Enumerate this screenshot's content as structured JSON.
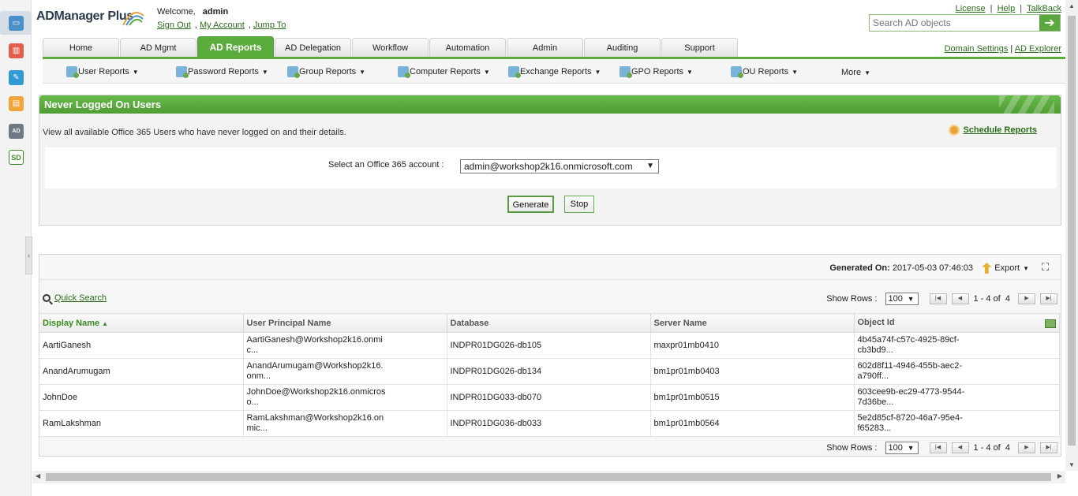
{
  "header": {
    "logo_text": "ADManager Plus",
    "welcome_label": "Welcome,",
    "username": "admin",
    "sign_out": "Sign Out",
    "my_account": "My Account",
    "jump_to": "Jump To",
    "top_links": [
      "License",
      "Help",
      "TalkBack"
    ],
    "search_placeholder": "Search AD objects"
  },
  "tabs": [
    {
      "label": "Home"
    },
    {
      "label": "AD Mgmt"
    },
    {
      "label": "AD Reports",
      "active": true
    },
    {
      "label": "AD Delegation"
    },
    {
      "label": "Workflow"
    },
    {
      "label": "Automation"
    },
    {
      "label": "Admin"
    },
    {
      "label": "Auditing"
    },
    {
      "label": "Support"
    }
  ],
  "domain_links": [
    "Domain Settings",
    "AD Explorer"
  ],
  "submenu": [
    {
      "label": "User Reports"
    },
    {
      "label": "Password Reports"
    },
    {
      "label": "Group Reports"
    },
    {
      "label": "Computer Reports"
    },
    {
      "label": "Exchange Reports"
    },
    {
      "label": "GPO Reports"
    },
    {
      "label": "OU Reports"
    },
    {
      "label": "More"
    }
  ],
  "report": {
    "title": "Never Logged On Users",
    "description": "View all available Office 365 Users who have never logged on and their details.",
    "schedule_label": "Schedule Reports",
    "account_label": "Select an Office 365 account :",
    "account_value": "admin@workshop2k16.onmicrosoft.com",
    "generate_label": "Generate",
    "stop_label": "Stop"
  },
  "results": {
    "generated_label": "Generated On:",
    "generated_value": "2017-05-03 07:46:03",
    "export_label": "Export",
    "quick_search": "Quick Search",
    "show_rows_label": "Show Rows :",
    "show_rows_value": "100",
    "page_range": "1 - 4 of",
    "page_total": "4",
    "columns": [
      "Display Name",
      "User Principal Name",
      "Database",
      "Server Name",
      "Object Id"
    ],
    "rows": [
      [
        "AartiGanesh",
        "AartiGanesh@Workshop2k16.onmi\nc...",
        "INDPR01DG026-db105",
        "maxpr01mb0410",
        "4b45a74f-c57c-4925-89cf-\ncb3bd9..."
      ],
      [
        "AnandArumugam",
        "AnandArumugam@Workshop2k16.\nonm...",
        "INDPR01DG026-db134",
        "bm1pr01mb0403",
        "602d8f11-4946-455b-aec2-\na790ff..."
      ],
      [
        "JohnDoe",
        "JohnDoe@Workshop2k16.onmicros\no...",
        "INDPR01DG033-db070",
        "bm1pr01mb0515",
        "603cee9b-ec29-4773-9544-\n7d36be..."
      ],
      [
        "RamLakshman",
        "RamLakshman@Workshop2k16.on\nmic...",
        "INDPR01DG036-db033",
        "bm1pr01mb0564",
        "5e2d85cf-8720-46a7-95e4-\nf65283..."
      ]
    ]
  },
  "left_rail_icons": [
    "monitor-icon",
    "reports-icon",
    "tools-icon",
    "document-icon",
    "ad360-icon",
    "sdp-icon"
  ],
  "colors": {
    "accent": "#5aac3d",
    "link": "#2a6e1a"
  }
}
